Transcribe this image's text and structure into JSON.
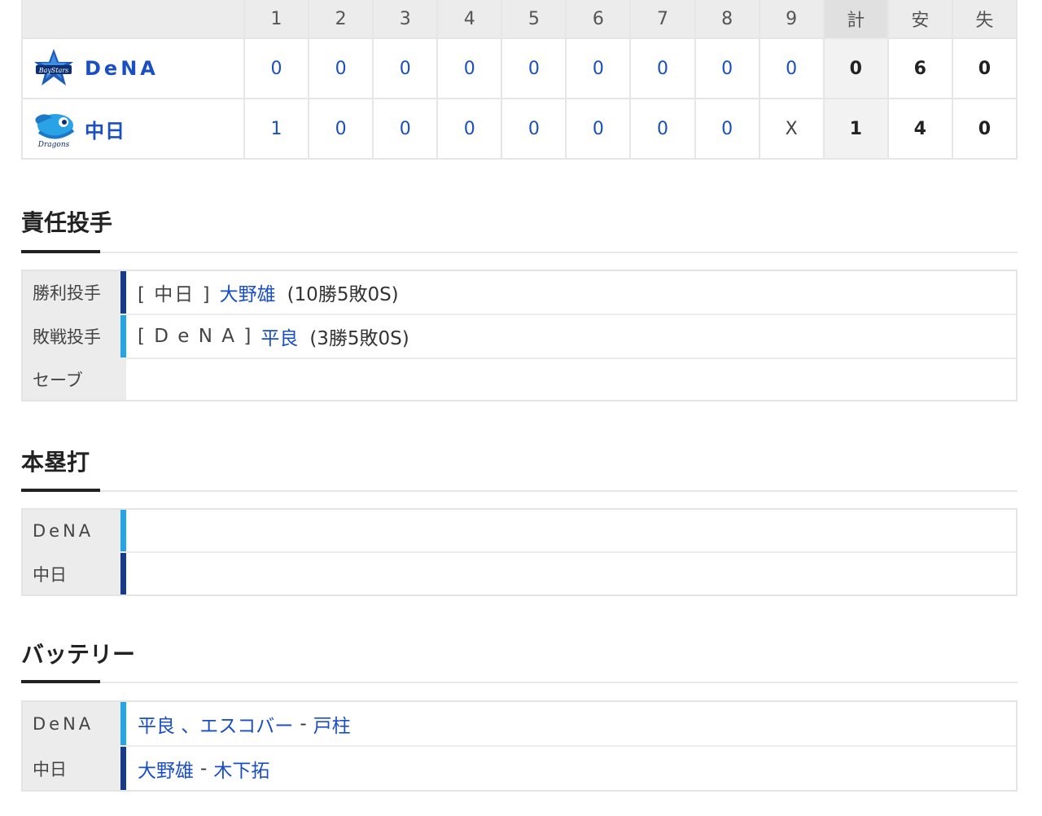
{
  "scoreboard": {
    "headers": [
      "1",
      "2",
      "3",
      "4",
      "5",
      "6",
      "7",
      "8",
      "9",
      "計",
      "安",
      "失"
    ],
    "teams": [
      {
        "name": "DeNA",
        "logo": "baystars-logo",
        "innings": [
          "0",
          "0",
          "0",
          "0",
          "0",
          "0",
          "0",
          "0",
          "0"
        ],
        "total": "0",
        "hits": "6",
        "errors": "0"
      },
      {
        "name": "中日",
        "logo": "dragons-logo",
        "innings": [
          "1",
          "0",
          "0",
          "0",
          "0",
          "0",
          "0",
          "0",
          "X"
        ],
        "total": "1",
        "hits": "4",
        "errors": "0"
      }
    ]
  },
  "pitchers": {
    "title": "責任投手",
    "win": {
      "label": "勝利投手",
      "team": "[ 中日 ]",
      "player": "大野雄",
      "record": "(10勝5敗0S)"
    },
    "loss": {
      "label": "敗戦投手",
      "team": "[ D e N A ]",
      "player": "平良",
      "record": "(3勝5敗0S)"
    },
    "save": {
      "label": "セーブ"
    }
  },
  "homeruns": {
    "title": "本塁打",
    "rows": [
      {
        "label": "DeNA"
      },
      {
        "label": "中日"
      }
    ]
  },
  "battery": {
    "title": "バッテリー",
    "rows": [
      {
        "label": "DeNA",
        "pitchers": "平良 、エスコバー",
        "sep": "-",
        "catcher": "戸柱"
      },
      {
        "label": "中日",
        "pitchers": "大野雄",
        "sep": "-",
        "catcher": "木下拓"
      }
    ]
  },
  "colors": {
    "link": "#1a4fc4",
    "navy": "#173a8a",
    "light_blue": "#27a4e4",
    "header_bg": "#ececec"
  }
}
